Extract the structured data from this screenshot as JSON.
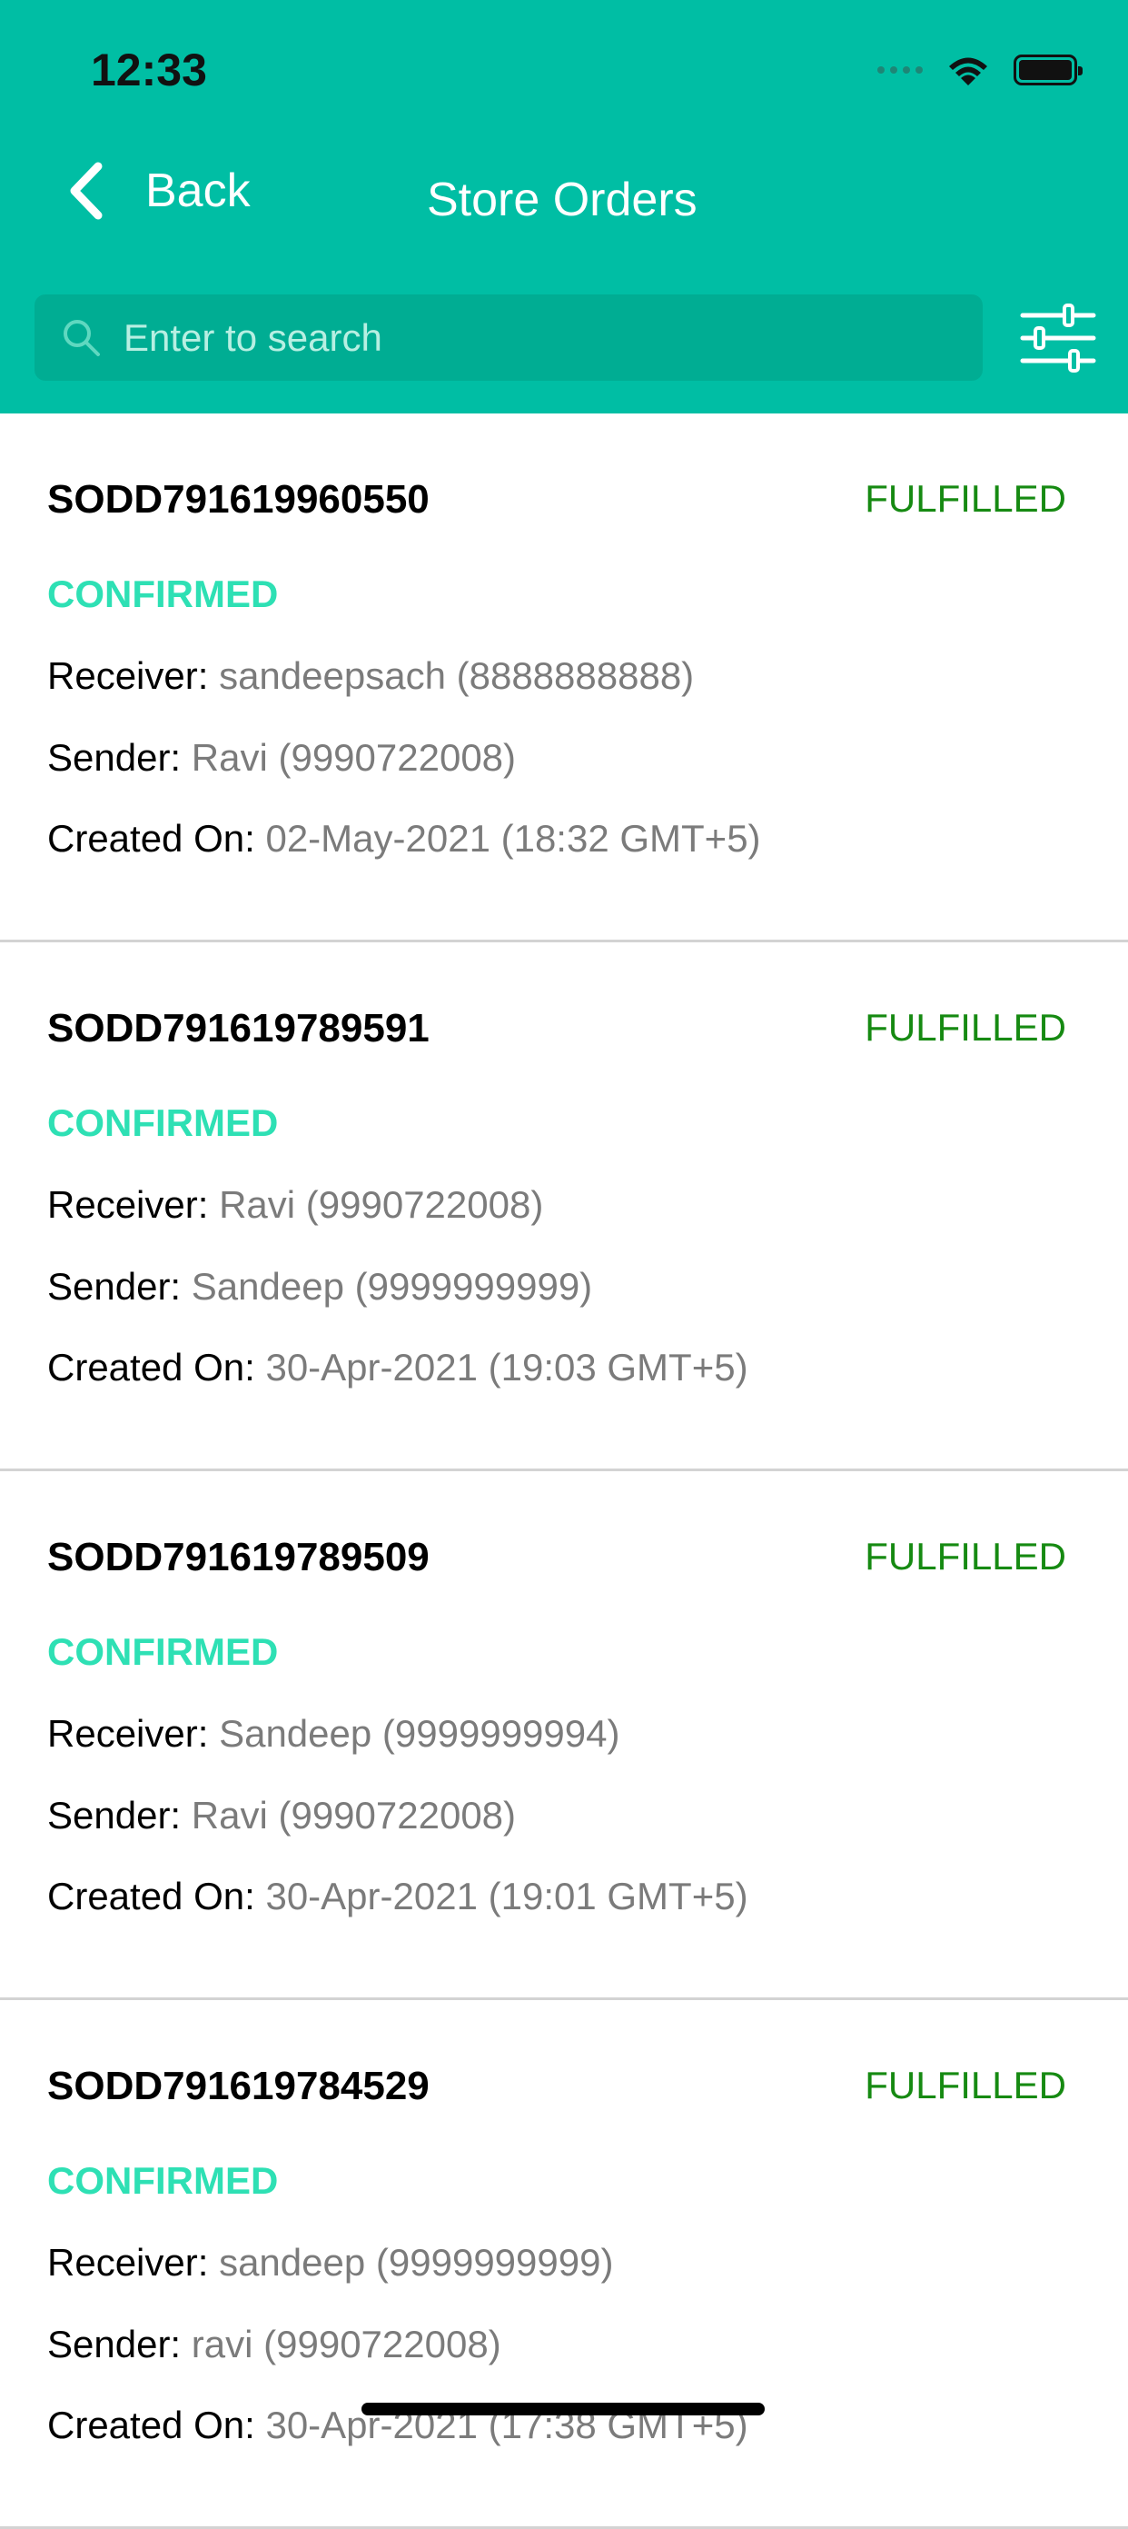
{
  "status_bar": {
    "time": "12:33"
  },
  "nav": {
    "back_label": "Back",
    "title": "Store Orders"
  },
  "search": {
    "placeholder": "Enter to search"
  },
  "labels": {
    "receiver": "Receiver:",
    "sender": "Sender:",
    "created_on": "Created On:"
  },
  "orders": [
    {
      "id": "SODD791619960550",
      "status": "FULFILLED",
      "confirmation": "CONFIRMED",
      "receiver": "sandeepsach (8888888888)",
      "sender": "Ravi (9990722008)",
      "created_on": "02-May-2021 (18:32 GMT+5)"
    },
    {
      "id": "SODD791619789591",
      "status": "FULFILLED",
      "confirmation": "CONFIRMED",
      "receiver": "Ravi (9990722008)",
      "sender": "Sandeep (9999999999)",
      "created_on": "30-Apr-2021 (19:03 GMT+5)"
    },
    {
      "id": "SODD791619789509",
      "status": "FULFILLED",
      "confirmation": "CONFIRMED",
      "receiver": "Sandeep (9999999994)",
      "sender": "Ravi (9990722008)",
      "created_on": "30-Apr-2021 (19:01 GMT+5)"
    },
    {
      "id": "SODD791619784529",
      "status": "FULFILLED",
      "confirmation": "CONFIRMED",
      "receiver": "sandeep (9999999999)",
      "sender": "ravi (9990722008)",
      "created_on": "30-Apr-2021 (17:38 GMT+5)"
    }
  ],
  "colors": {
    "header": "#00bea4",
    "search_bg": "#00ad93",
    "fulfilled": "#168a12",
    "confirmed": "#2ee0b4"
  },
  "icons": [
    "back-chevron-icon",
    "search-icon",
    "filter-sliders-icon",
    "wifi-icon",
    "battery-icon",
    "signal-icon"
  ]
}
